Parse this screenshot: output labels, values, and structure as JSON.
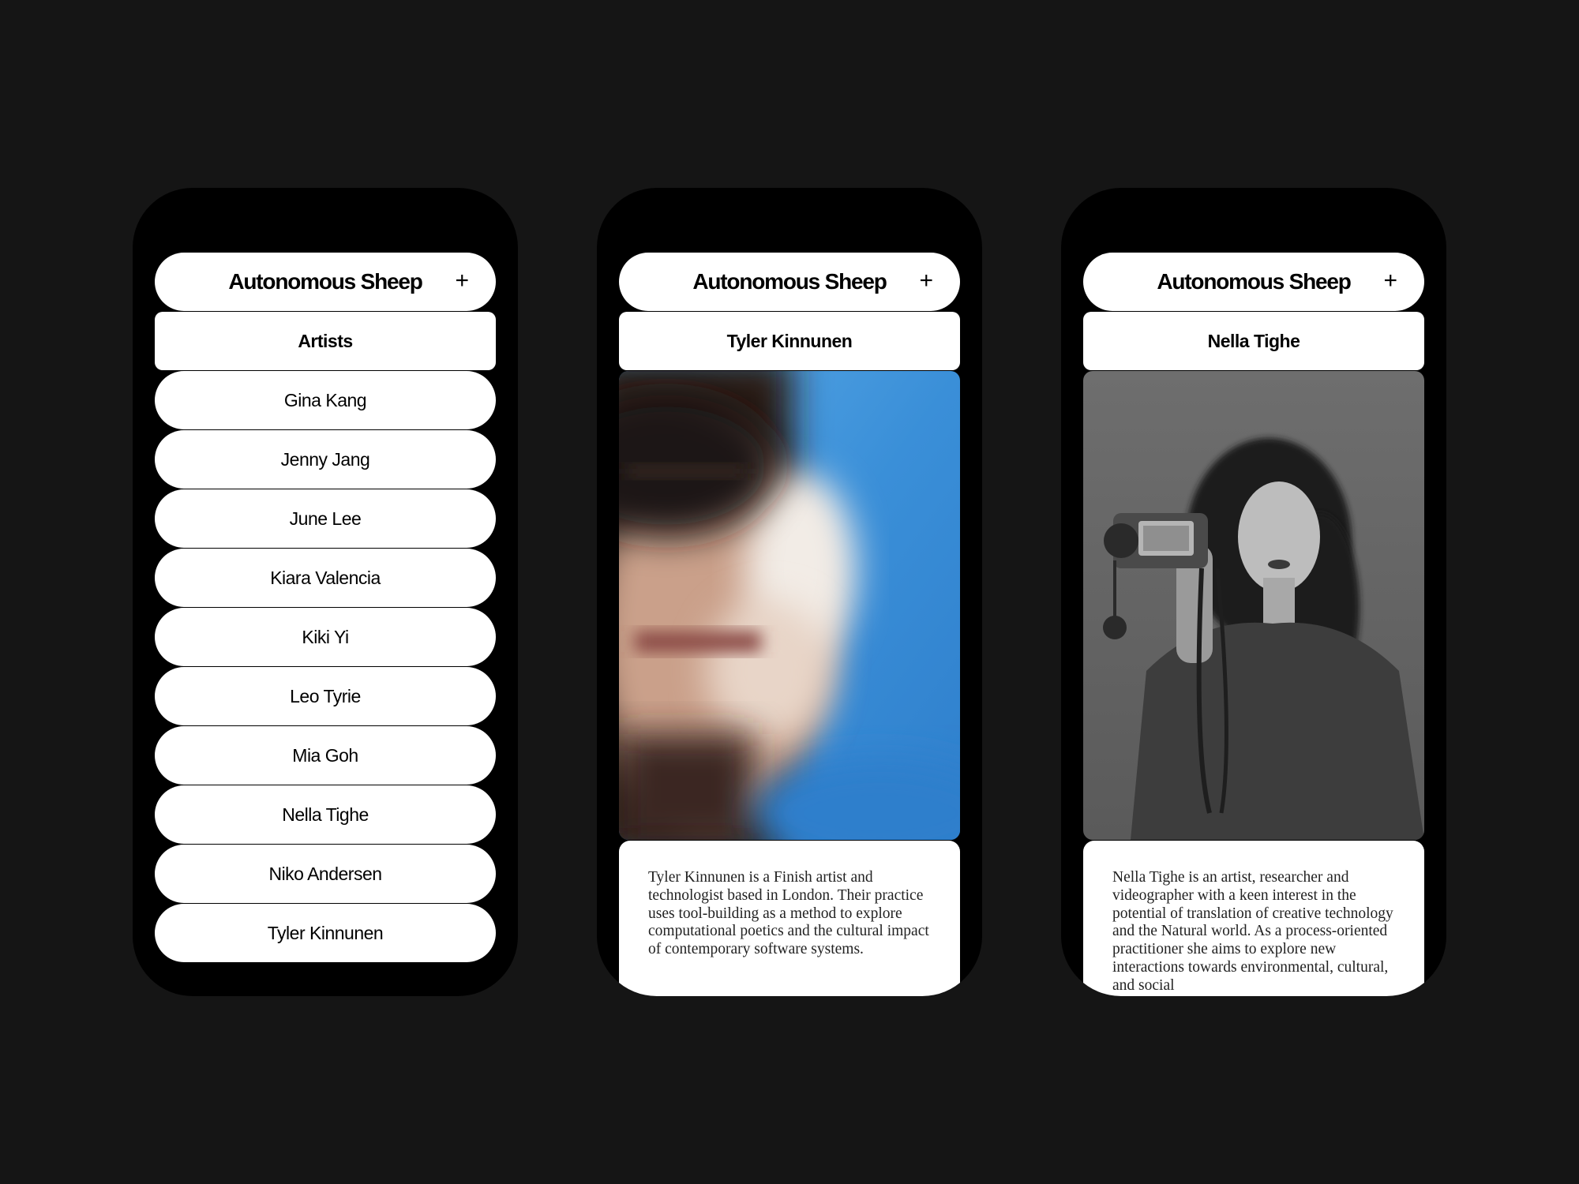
{
  "app": {
    "brand": "Autonomous Sheep",
    "plus_label": "+"
  },
  "screens": [
    {
      "section_title": "Artists",
      "artists": [
        "Gina Kang",
        "Jenny Jang",
        "June Lee",
        "Kiara Valencia",
        "Kiki Yi",
        "Leo Tyrie",
        "Mia Goh",
        "Nella Tighe",
        "Niko Andersen",
        "Tyler Kinnunen"
      ]
    },
    {
      "section_title": "Tyler Kinnunen",
      "bio": "Tyler Kinnunen is a Finish artist and technologist based in London. Their practice uses tool-building as a method to explore computational poetics and the cultural impact of contemporary software systems."
    },
    {
      "section_title": "Nella Tighe",
      "bio": "Nella Tighe is an artist, researcher and videographer with a keen interest in the potential of translation of creative technology and the Natural world. As a process-oriented practitioner she aims to explore new interactions towards environmental, cultural, and social"
    }
  ],
  "colors": {
    "background": "#151515",
    "phone": "#000000",
    "card": "#ffffff",
    "photo_blue": "#3a8fd8"
  }
}
